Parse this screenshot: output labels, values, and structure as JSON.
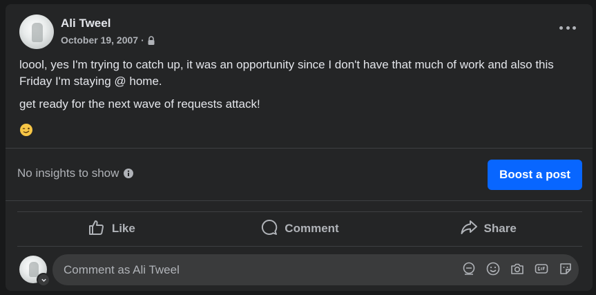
{
  "post": {
    "author": "Ali Tweel",
    "date": "October 19, 2007",
    "separator": "·",
    "privacy_icon": "lock-icon",
    "paragraphs": [
      "loool, yes I'm trying to catch up, it was an opportunity since I don't have that much of work and also this Friday I'm staying @ home.",
      "get ready for the next wave of requests attack!"
    ],
    "emoji": "winking-face-icon"
  },
  "insights": {
    "text": "No insights to show",
    "boost_label": "Boost a post"
  },
  "actions": {
    "like": "Like",
    "comment": "Comment",
    "share": "Share"
  },
  "composer": {
    "placeholder": "Comment as Ali Tweel",
    "tools": [
      "avatar-sticker-icon",
      "emoji-icon",
      "camera-icon",
      "gif-icon",
      "sticker-icon"
    ]
  },
  "colors": {
    "background": "#18191a",
    "card": "#242526",
    "accent": "#0866ff",
    "input": "#3a3b3c",
    "secondary_text": "#b0b3b8"
  }
}
